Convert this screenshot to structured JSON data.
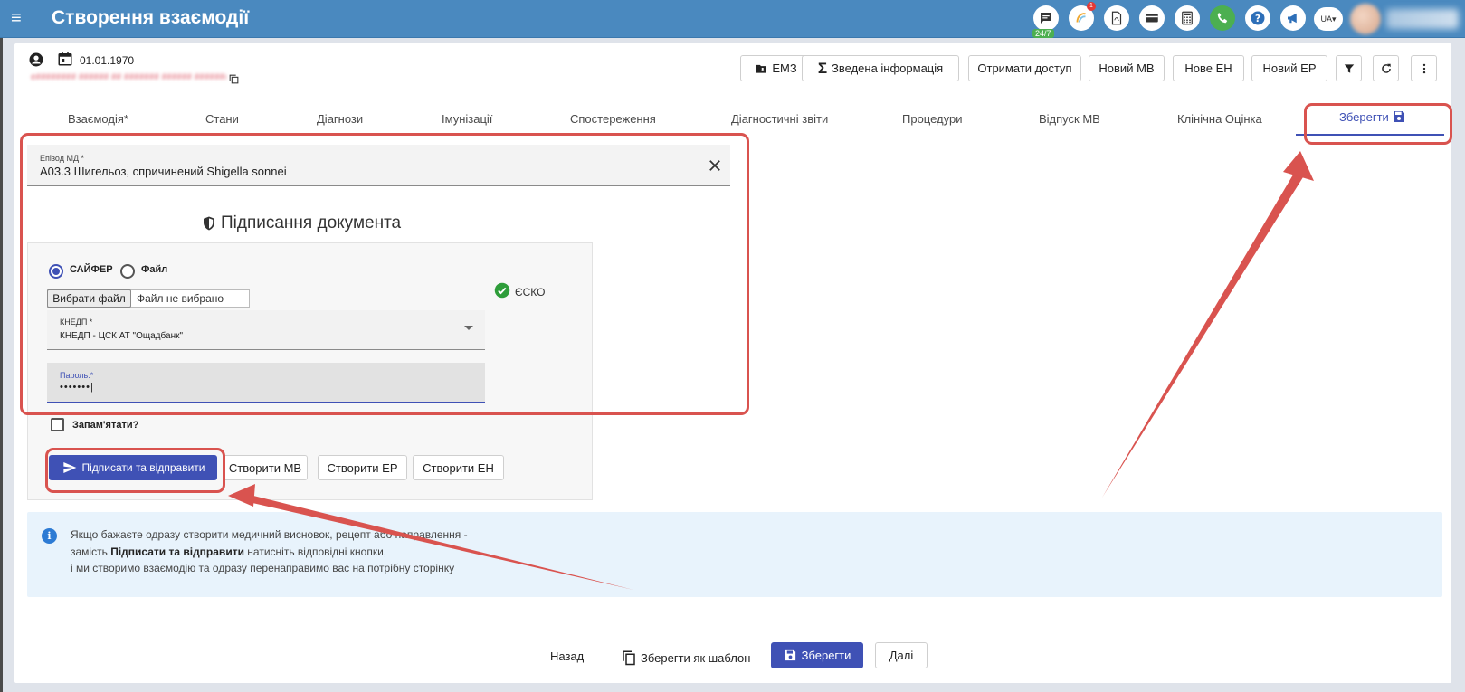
{
  "header": {
    "menu_icon": "menu-icon",
    "title": "Створення взаємодії",
    "support_badge": "24/7",
    "notification_count": "1",
    "lang": "UA",
    "icons": [
      "chat-icon",
      "integration-icon",
      "pdf-icon",
      "card-icon",
      "calculator-icon",
      "phone-icon",
      "help-icon",
      "megaphone-icon"
    ]
  },
  "patient": {
    "birth_date": "01.01.1970",
    "blurred_id": "e######## ###### ## ####### ###### ###########"
  },
  "toolbar": {
    "emz": "ЕМЗ",
    "summary": "Зведена інформація",
    "get_access": "Отримати доступ",
    "new_mv": "Новий МВ",
    "new_en": "Нове ЕН",
    "new_er": "Новий ЕР"
  },
  "tabs": [
    "Взаємодія*",
    "Стани",
    "Діагнози",
    "Імунізації",
    "Спостереження",
    "Діагностичні звіти",
    "Процедури",
    "Відпуск МВ",
    "Клінічна Оцінка"
  ],
  "tab_save": "Зберегти",
  "episode": {
    "label": "Епізод МД *",
    "value": "A03.3 Шигельоз, спричинений Shigella sonnei"
  },
  "sign": {
    "title": "Підписання документа",
    "radio_cipher": "САЙФЕР",
    "radio_file": "Файл",
    "file_button": "Вибрати файл",
    "file_none": "Файл не вибрано",
    "esko": "ЄСКО",
    "kn_label": "КНЕДП *",
    "kn_value": "КНЕДП - ЦСК АТ \"Ощадбанк\"",
    "password_label": "Пароль:*",
    "password_value": "•••••••|",
    "remember": "Запам'ятати?",
    "submit": "Підписати та відправити",
    "create_mv": "Створити МВ",
    "create_er": "Створити ЕР",
    "create_en": "Створити ЕН"
  },
  "info": {
    "line1": "Якщо бажаєте одразу створити медичний висновок, рецепт або направлення -",
    "line2_pre": "замість ",
    "line2_bold": "Підписати та відправити",
    "line2_post": " натисніть відповідні кнопки,",
    "line3": "і ми створимо взаємодію та одразу перенаправимо вас на потрібну сторінку"
  },
  "footer": {
    "back": "Назад",
    "save_template": "Зберегти як шаблон",
    "save": "Зберегти",
    "next": "Далі"
  },
  "colors": {
    "header": "#4a89bf",
    "primary": "#3f51b5",
    "annotation": "#d9534f",
    "info_bg": "#e8f3fc"
  }
}
